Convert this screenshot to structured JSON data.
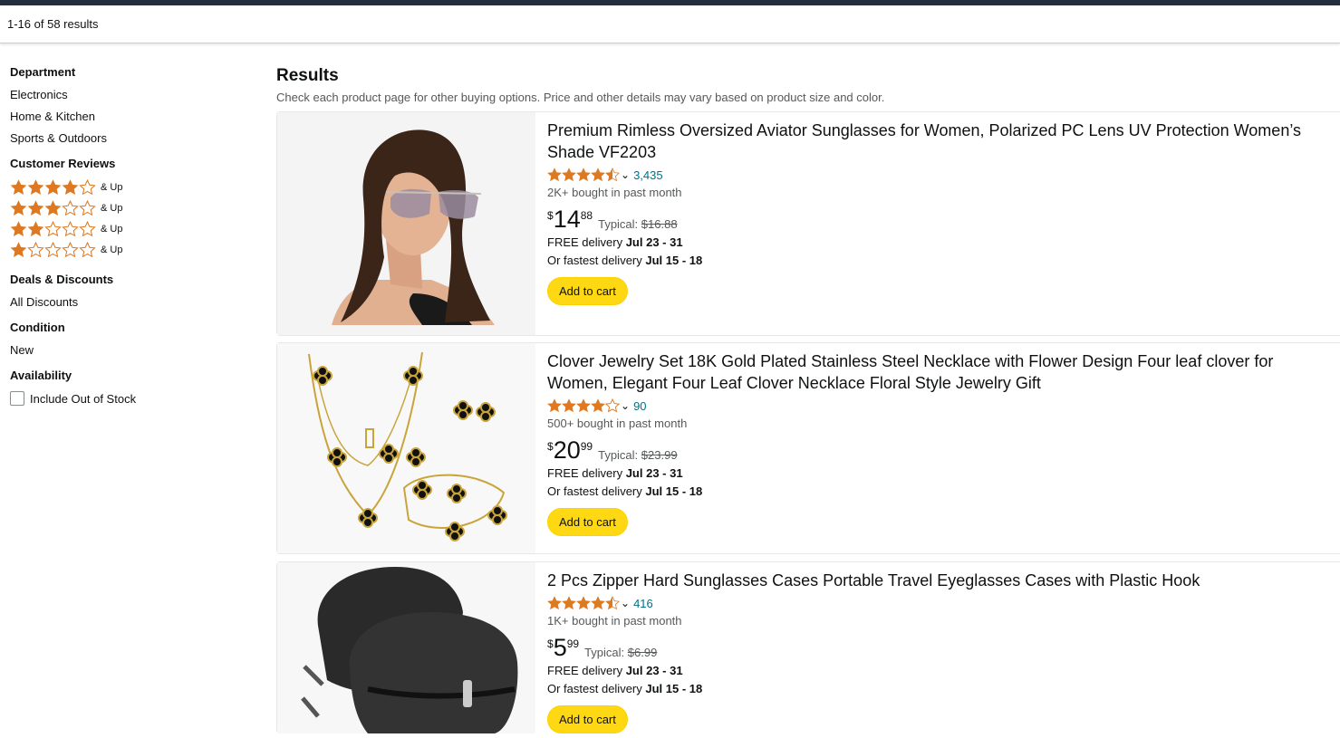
{
  "results_bar": {
    "text": "1-16 of 58 results"
  },
  "sidebar": {
    "department": {
      "heading": "Department",
      "items": [
        "Electronics",
        "Home & Kitchen",
        "Sports & Outdoors"
      ]
    },
    "reviews": {
      "heading": "Customer Reviews",
      "and_up": "& Up",
      "levels": [
        4,
        3,
        2,
        1
      ]
    },
    "deals": {
      "heading": "Deals & Discounts",
      "items": [
        "All Discounts"
      ]
    },
    "condition": {
      "heading": "Condition",
      "items": [
        "New"
      ]
    },
    "availability": {
      "heading": "Availability",
      "checkbox_label": "Include Out of Stock"
    }
  },
  "main": {
    "heading": "Results",
    "subtitle": "Check each product page for other buying options. Price and other details may vary based on product size and color."
  },
  "products": [
    {
      "title": "Premium Rimless Oversized Aviator Sunglasses for Women, Polarized PC Lens UV Protection Women’s Shade VF2203",
      "rating": 4.5,
      "review_count": "3,435",
      "bought": "2K+ bought in past month",
      "price_symbol": "$",
      "price_whole": "14",
      "price_fraction": "88",
      "typical_label": "Typical:",
      "typical_price": "$16.88",
      "delivery_prefix": "FREE delivery ",
      "delivery_dates": "Jul 23 - 31",
      "fastest_prefix": "Or fastest delivery ",
      "fastest_dates": "Jul 15 - 18",
      "cta": "Add to cart"
    },
    {
      "title": "Clover Jewelry Set 18K Gold Plated Stainless Steel Necklace with Flower Design Four leaf clover for Women, Elegant Four Leaf Clover Necklace Floral Style Jewelry Gift",
      "rating": 4.0,
      "review_count": "90",
      "bought": "500+ bought in past month",
      "price_symbol": "$",
      "price_whole": "20",
      "price_fraction": "99",
      "typical_label": "Typical:",
      "typical_price": "$23.99",
      "delivery_prefix": "FREE delivery ",
      "delivery_dates": "Jul 23 - 31",
      "fastest_prefix": "Or fastest delivery ",
      "fastest_dates": "Jul 15 - 18",
      "cta": "Add to cart"
    },
    {
      "title": "2 Pcs Zipper Hard Sunglasses Cases Portable Travel Eyeglasses Cases with Plastic Hook",
      "rating": 4.5,
      "review_count": "416",
      "bought": "1K+ bought in past month",
      "price_symbol": "$",
      "price_whole": "5",
      "price_fraction": "99",
      "typical_label": "Typical:",
      "typical_price": "$6.99",
      "delivery_prefix": "FREE delivery ",
      "delivery_dates": "Jul 23 - 31",
      "fastest_prefix": "Or fastest delivery ",
      "fastest_dates": "Jul 15 - 18",
      "cta": "Add to cart"
    }
  ],
  "colors": {
    "star": "#de7921",
    "link": "#007185",
    "cart_button": "#ffd814",
    "header": "#232f3e"
  }
}
